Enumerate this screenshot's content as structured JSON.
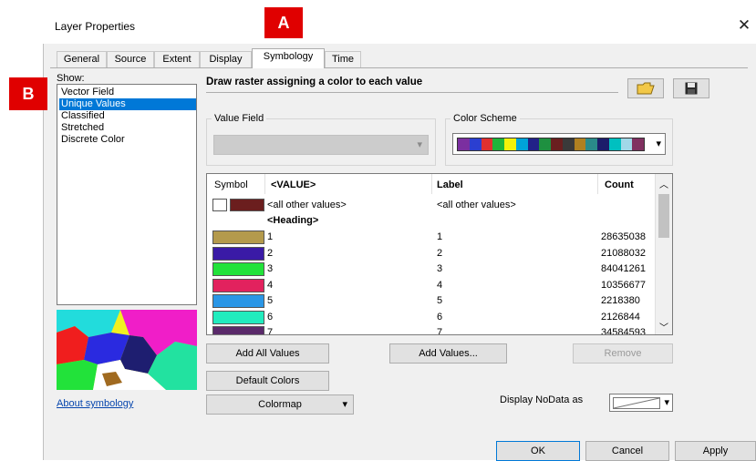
{
  "window": {
    "title": "Layer Properties",
    "close_glyph": "✕"
  },
  "tabs": [
    {
      "label": "General"
    },
    {
      "label": "Source"
    },
    {
      "label": "Extent"
    },
    {
      "label": "Display"
    },
    {
      "label": "Symbology",
      "active": true
    },
    {
      "label": "Time"
    }
  ],
  "markers": {
    "a": "A",
    "b": "B"
  },
  "show": {
    "label": "Show:",
    "items": [
      "Vector Field",
      "Unique Values",
      "Classified",
      "Stretched",
      "Discrete Color"
    ],
    "selected_index": 1
  },
  "description": "Draw raster assigning a color to each value",
  "toolbar_icons": [
    "open-folder-icon",
    "save-disk-icon"
  ],
  "value_field": {
    "label": "Value Field",
    "value": ""
  },
  "color_scheme": {
    "label": "Color Scheme",
    "colors": [
      "#7b2fa0",
      "#2b3fd1",
      "#e03030",
      "#1fb53a",
      "#f2f20a",
      "#00a3d9",
      "#222288",
      "#1e9040",
      "#6a1f1f",
      "#3a3a3a",
      "#b08020",
      "#2a8a8a",
      "#1c1c6a",
      "#00c0c0",
      "#a0d8e8",
      "#803060"
    ]
  },
  "table": {
    "headers": {
      "symbol": "Symbol",
      "value": "<VALUE>",
      "label": "Label",
      "count": "Count"
    },
    "other": {
      "value": "<all other values>",
      "label": "<all other values>",
      "color": "#6b1e1e"
    },
    "heading": "<Heading>",
    "rows": [
      {
        "value": "1",
        "label": "1",
        "count": "28635038",
        "color": "#b49a4c"
      },
      {
        "value": "2",
        "label": "2",
        "count": "21088032",
        "color": "#3a1aa6"
      },
      {
        "value": "3",
        "label": "3",
        "count": "84041261",
        "color": "#22e23a"
      },
      {
        "value": "4",
        "label": "4",
        "count": "10356677",
        "color": "#e2225e"
      },
      {
        "value": "5",
        "label": "5",
        "count": "2218380",
        "color": "#2a96e6"
      },
      {
        "value": "6",
        "label": "6",
        "count": "2126844",
        "color": "#22ecbe"
      },
      {
        "value": "7",
        "label": "7",
        "count": "34584593",
        "color": "#5a2a6a"
      }
    ]
  },
  "buttons": {
    "add_all_values": "Add All Values",
    "add_values": "Add Values...",
    "remove": "Remove",
    "default_colors": "Default Colors",
    "colormap": "Colormap",
    "ok": "OK",
    "cancel": "Cancel",
    "apply": "Apply"
  },
  "about_link": "About symbology",
  "nodata": {
    "label": "Display NoData as"
  },
  "dropdown_glyph": "▾"
}
